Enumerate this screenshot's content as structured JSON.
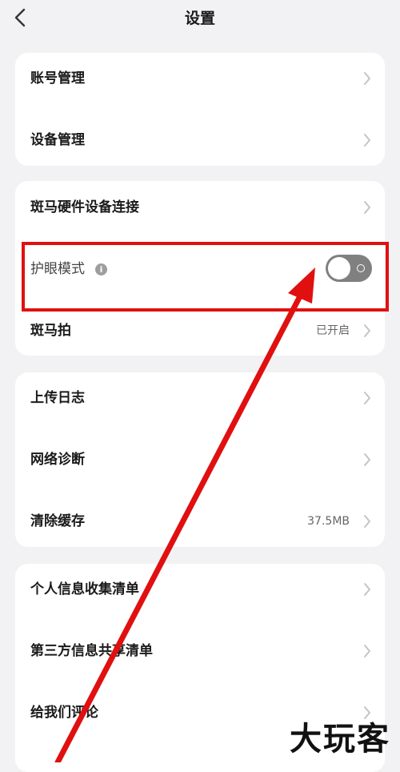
{
  "nav": {
    "title": "设置"
  },
  "sections": [
    {
      "items": [
        {
          "label": "账号管理"
        },
        {
          "label": "设备管理"
        }
      ]
    },
    {
      "items": [
        {
          "label": "斑马硬件设备连接"
        },
        {
          "label": "护眼模式",
          "toggle_on": false
        },
        {
          "label": "斑马拍",
          "value": "已开启"
        }
      ]
    },
    {
      "items": [
        {
          "label": "上传日志"
        },
        {
          "label": "网络诊断"
        },
        {
          "label": "清除缓存",
          "value": "37.5MB"
        }
      ]
    },
    {
      "items": [
        {
          "label": "个人信息收集清单"
        },
        {
          "label": "第三方信息共享清单"
        },
        {
          "label": "给我们评论"
        }
      ]
    }
  ],
  "annotation": {
    "highlight_color": "#e01010"
  },
  "watermark": "大玩客"
}
